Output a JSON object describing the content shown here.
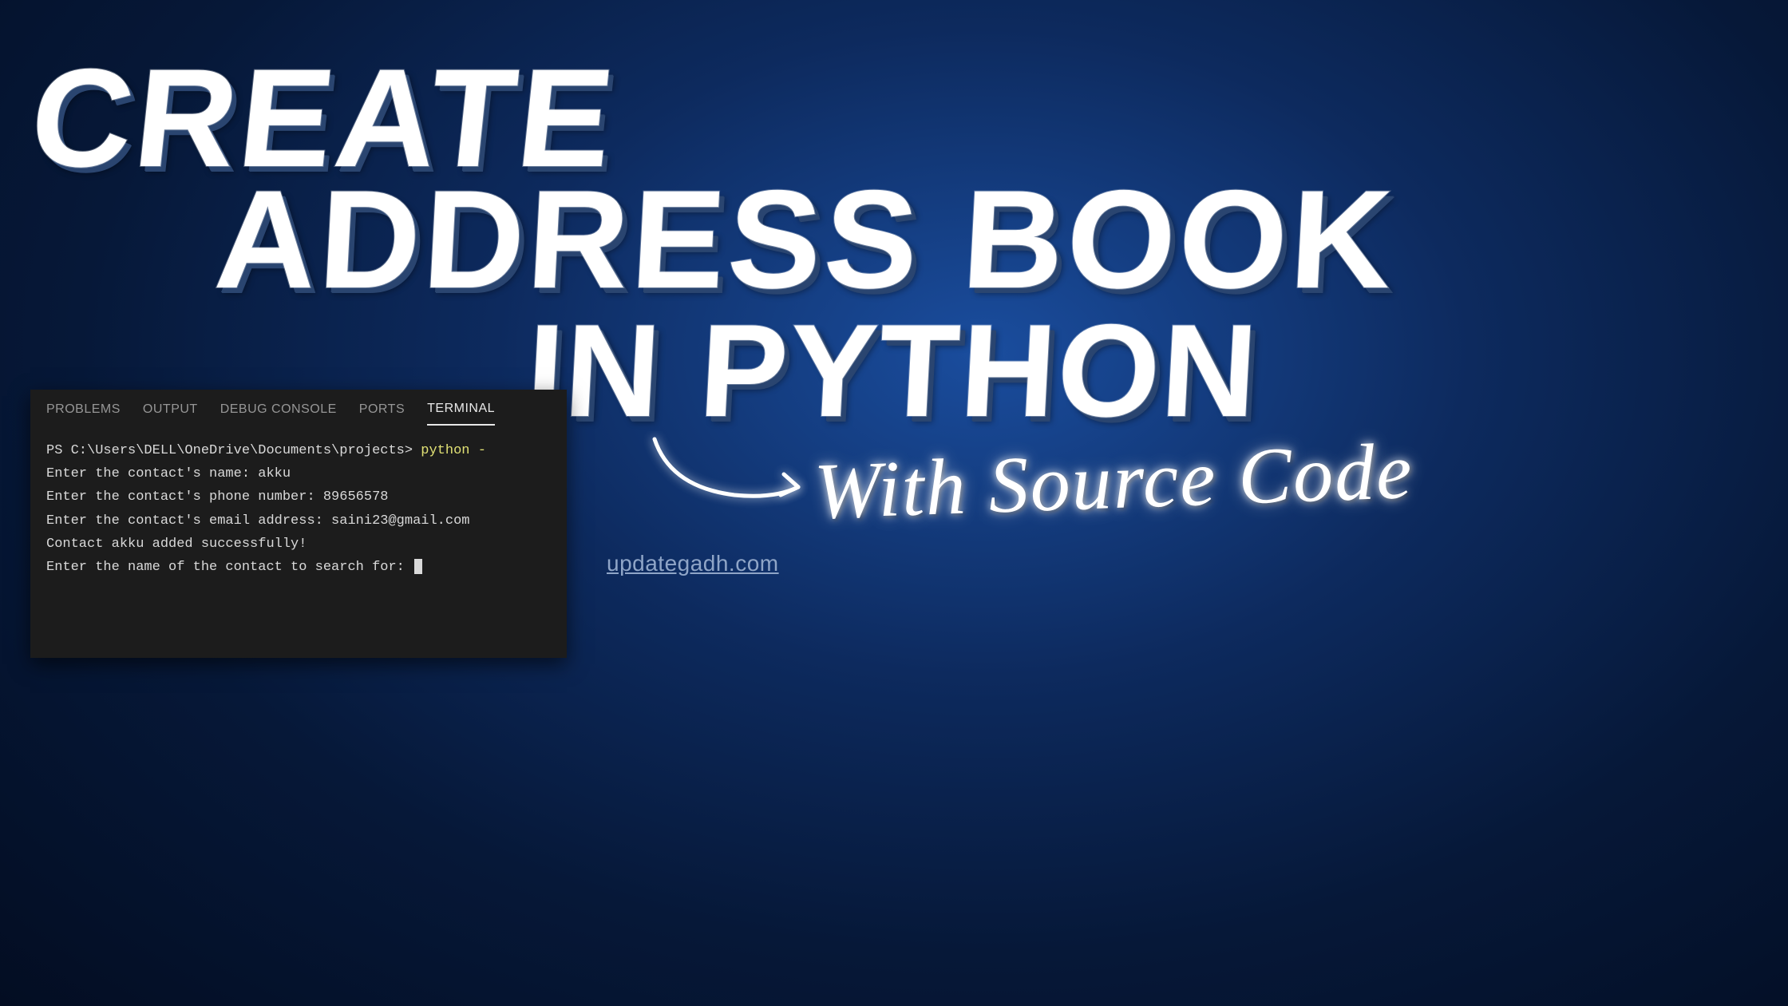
{
  "headline": {
    "line1": "CREATE",
    "line2": "ADDRESS BOOK",
    "line3": "IN PYTHON"
  },
  "script_label": "With Source Code",
  "website_link": "updategadh.com",
  "terminal": {
    "tabs": [
      {
        "label": "PROBLEMS",
        "active": false
      },
      {
        "label": "OUTPUT",
        "active": false
      },
      {
        "label": "DEBUG CONSOLE",
        "active": false
      },
      {
        "label": "PORTS",
        "active": false
      },
      {
        "label": "TERMINAL",
        "active": true
      }
    ],
    "prompt_path": "PS C:\\Users\\DELL\\OneDrive\\Documents\\projects> ",
    "command": "python -",
    "lines": [
      "Enter the contact's name: akku",
      "Enter the contact's phone number: 89656578",
      "Enter the contact's email address: saini23@gmail.com",
      "Contact akku added successfully!",
      "Enter the name of the contact to search for: "
    ]
  }
}
